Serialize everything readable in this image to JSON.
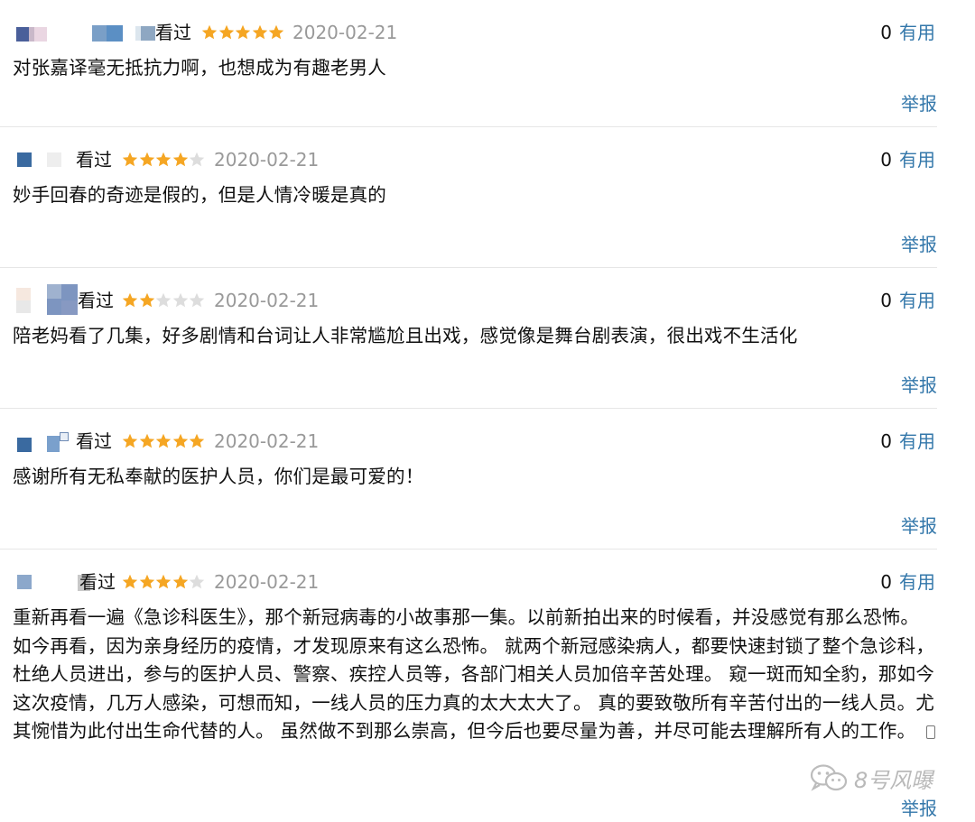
{
  "reviews": [
    {
      "status": "看过",
      "rating": 5,
      "date": "2020-02-21",
      "useful_count": "0",
      "useful_label": "有用",
      "text": "对张嘉译毫无抵抗力啊，也想成为有趣老男人",
      "report_label": "举报"
    },
    {
      "status": "看过",
      "rating": 4,
      "date": "2020-02-21",
      "useful_count": "0",
      "useful_label": "有用",
      "text": "妙手回春的奇迹是假的，但是人情冷暖是真的",
      "report_label": "举报"
    },
    {
      "status": "看过",
      "rating": 2,
      "date": "2020-02-21",
      "useful_count": "0",
      "useful_label": "有用",
      "text": "陪老妈看了几集，好多剧情和台词让人非常尴尬且出戏，感觉像是舞台剧表演，很出戏不生活化",
      "report_label": "举报"
    },
    {
      "status": "看过",
      "rating": 5,
      "date": "2020-02-21",
      "useful_count": "0",
      "useful_label": "有用",
      "text": "感谢所有无私奉献的医护人员，你们是最可爱的！",
      "report_label": "举报"
    },
    {
      "status": "看过",
      "rating": 4,
      "date": "2020-02-21",
      "useful_count": "0",
      "useful_label": "有用",
      "text": "重新再看一遍《急诊科医生》，那个新冠病毒的小故事那一集。以前新拍出来的时候看，并没感觉有那么恐怖。如今再看，因为亲身经历的疫情，才发现原来有这么恐怖。 就两个新冠感染病人，都要快速封锁了整个急诊科，杜绝人员进出，参与的医护人员、警察、疾控人员等，各部门相关人员加倍辛苦处理。 窥一斑而知全豹，那如今这次疫情，几万人感染，可想而知，一线人员的压力真的太大太大了。 真的要致敬所有辛苦付出的一线人员。尤其惋惜为此付出生命代替的人。 虽然做不到那么崇高，但今后也要尽量为善，并尽可能去理解所有人的工作。",
      "report_label": "举报"
    }
  ],
  "watermark": {
    "text": "8号风曝"
  },
  "colors": {
    "star_filled": "#f5a623",
    "star_empty": "#dddddd",
    "link": "#3377aa",
    "date": "#999999"
  },
  "icons": {
    "star": "star-icon",
    "phone": "phone-icon",
    "wechat": "wechat-icon"
  }
}
